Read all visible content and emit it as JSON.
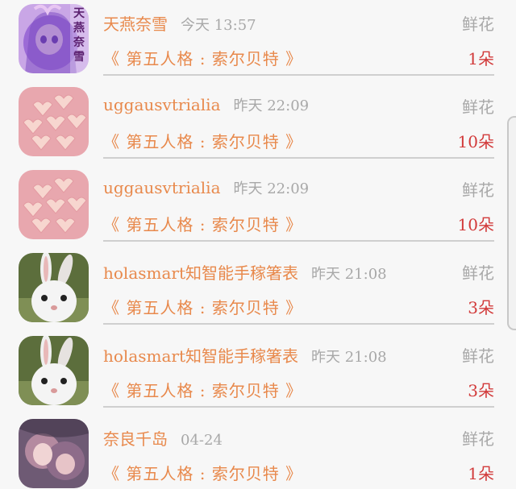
{
  "rows": [
    {
      "name": "天燕奈雪",
      "time": "今天 13:57",
      "gift_type": "鲜花",
      "work": "《 第五人格 : 索尔贝特 》",
      "qty": "1朵",
      "avatar": "anime-girl-avatar",
      "avatar_text": "天燕奈雪"
    },
    {
      "name": "uggausvtrialia",
      "time": "昨天 22:09",
      "gift_type": "鲜花",
      "work": "《 第五人格 : 索尔贝特 》",
      "qty": "10朵",
      "avatar": "marshmallow-avatar"
    },
    {
      "name": "uggausvtrialia",
      "time": "昨天 22:09",
      "gift_type": "鲜花",
      "work": "《 第五人格 : 索尔贝特 》",
      "qty": "10朵",
      "avatar": "marshmallow-avatar"
    },
    {
      "name": "holasmart知智能手稼箸表",
      "time": "昨天 21:08",
      "gift_type": "鲜花",
      "work": "《 第五人格 : 索尔贝特 》",
      "qty": "3朵",
      "avatar": "rabbit-avatar"
    },
    {
      "name": "holasmart知智能手稼箸表",
      "time": "昨天 21:08",
      "gift_type": "鲜花",
      "work": "《 第五人格 : 索尔贝特 》",
      "qty": "3朵",
      "avatar": "rabbit-avatar"
    },
    {
      "name": "奈良千岛",
      "time": "04-24",
      "gift_type": "鲜花",
      "work": "《 第五人格 : 索尔贝特 》",
      "qty": "1朵",
      "avatar": "anime-couple-avatar"
    }
  ],
  "colors": {
    "name": "#e8894c",
    "work": "#e8894c",
    "quantity": "#d23a3a",
    "muted": "#a8a8a8",
    "background": "#f7f7f7"
  }
}
